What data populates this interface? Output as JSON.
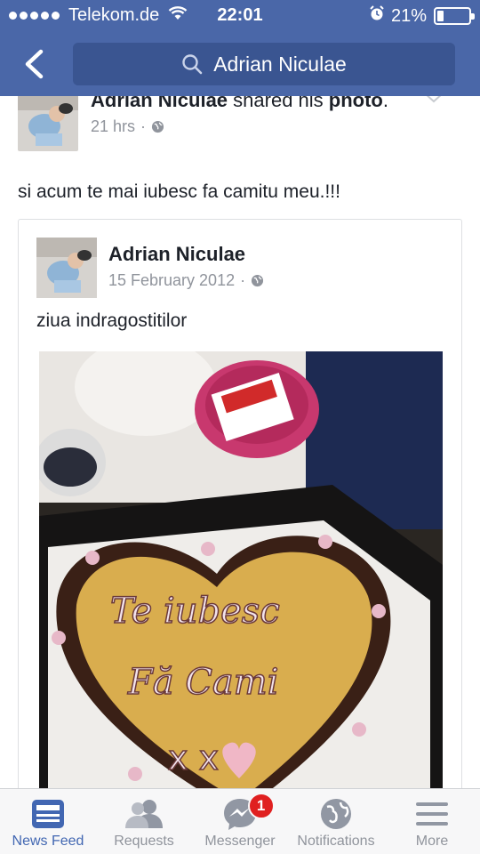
{
  "status_bar": {
    "carrier": "Telekom.de",
    "time": "22:01",
    "battery": "21%",
    "battery_level": 0.21
  },
  "nav": {
    "search_text": "Adrian Niculae"
  },
  "post": {
    "author": "Adrian Niculae",
    "action": " shared his ",
    "object": "photo",
    "period": ".",
    "time": "21 hrs",
    "separator": "·",
    "text": "si acum te mai iubesc fa camitu meu.!!!",
    "shared": {
      "author": "Adrian Niculae",
      "date": "15 February 2012",
      "separator": "·",
      "text": "ziua indragostitilor",
      "photo_text": [
        "Te iubesc",
        "Fă Cami",
        "x x"
      ]
    }
  },
  "tabbar": {
    "tabs": [
      {
        "label": "News Feed",
        "icon": "news-feed-icon",
        "active": true
      },
      {
        "label": "Requests",
        "icon": "friend-requests-icon"
      },
      {
        "label": "Messenger",
        "icon": "messenger-icon",
        "badge": "1"
      },
      {
        "label": "Notifications",
        "icon": "globe-icon"
      },
      {
        "label": "More",
        "icon": "menu-icon"
      }
    ]
  },
  "colors": {
    "brand_blue": "#4a67a8",
    "search_bg": "#3a5591",
    "active_tab": "#4267b2",
    "badge_red": "#e02020"
  }
}
